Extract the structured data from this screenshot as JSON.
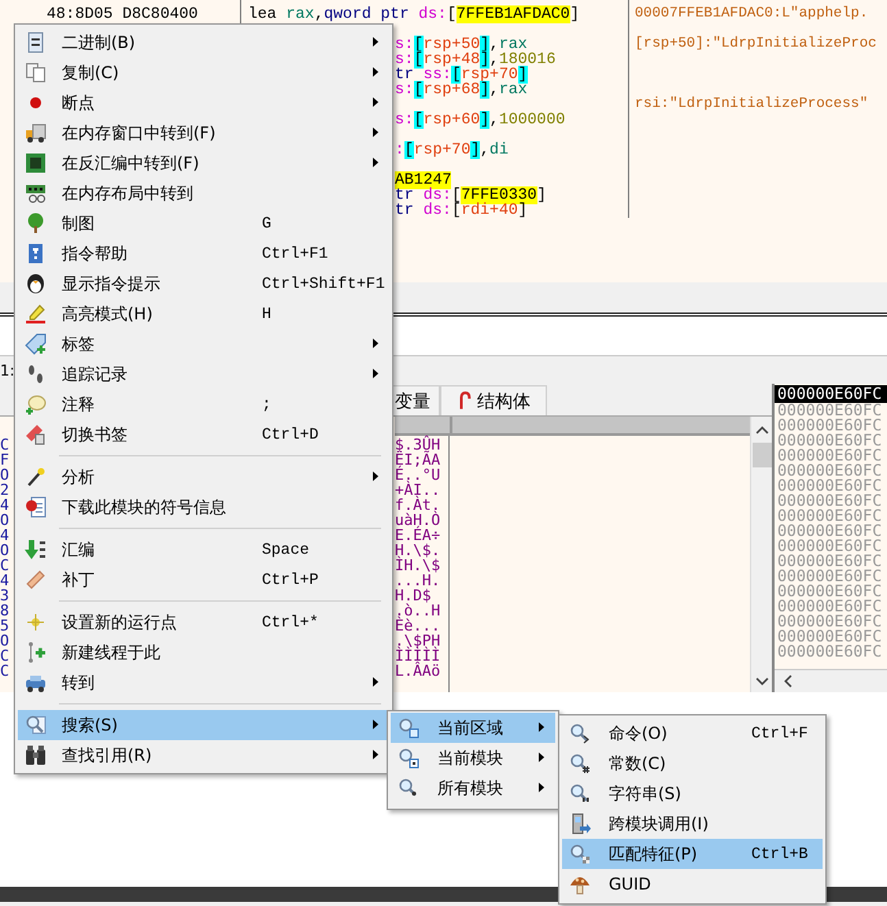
{
  "disassembly": {
    "rows": [
      {
        "kind": "covered"
      },
      {
        "kind": "full",
        "bytes": "48:8D05 D8C80400",
        "segments": [
          {
            "text": "lea ",
            "kind": "mnem"
          },
          {
            "text": "rax",
            "kind": "reg"
          },
          {
            "text": ",",
            "kind": "p"
          },
          {
            "text": "qword ptr ",
            "kind": "size"
          },
          {
            "text": "ds:",
            "kind": "seg"
          },
          {
            "text": "[",
            "kind": "p"
          },
          {
            "text": "7FFEB1AFDAC0",
            "kind": "addr"
          },
          {
            "text": "]",
            "kind": "p"
          }
        ],
        "comment": "00007FFEB1AFDAC0:L\"apphelp."
      },
      {
        "kind": "covered"
      },
      {
        "kind": "partial",
        "segments": [
          {
            "text": "s:",
            "kind": "seg"
          },
          {
            "text": "[",
            "kind": "br"
          },
          {
            "text": "rsp+50",
            "kind": "mem"
          },
          {
            "text": "]",
            "kind": "br"
          },
          {
            "text": ",",
            "kind": "p"
          },
          {
            "text": "rax",
            "kind": "reg"
          }
        ],
        "comment": "[rsp+50]:\"LdrpInitializeProc"
      },
      {
        "kind": "partial",
        "segments": [
          {
            "text": "s:",
            "kind": "seg"
          },
          {
            "text": "[",
            "kind": "br"
          },
          {
            "text": "rsp+48",
            "kind": "mem"
          },
          {
            "text": "]",
            "kind": "br"
          },
          {
            "text": ",",
            "kind": "p"
          },
          {
            "text": "180016",
            "kind": "num"
          }
        ]
      },
      {
        "kind": "partial",
        "segments": [
          {
            "text": "tr ",
            "kind": "size"
          },
          {
            "text": "ss:",
            "kind": "seg"
          },
          {
            "text": "[",
            "kind": "br"
          },
          {
            "text": "rsp+70",
            "kind": "mem"
          },
          {
            "text": "]",
            "kind": "br"
          }
        ]
      },
      {
        "kind": "partial",
        "segments": [
          {
            "text": "s:",
            "kind": "seg"
          },
          {
            "text": "[",
            "kind": "br"
          },
          {
            "text": "rsp+68",
            "kind": "mem"
          },
          {
            "text": "]",
            "kind": "br"
          },
          {
            "text": ",",
            "kind": "p"
          },
          {
            "text": "rax",
            "kind": "reg"
          }
        ]
      },
      {
        "kind": "covered",
        "comment": "rsi:\"LdrpInitializeProcess\""
      },
      {
        "kind": "partial",
        "segments": [
          {
            "text": "s:",
            "kind": "seg"
          },
          {
            "text": "[",
            "kind": "br"
          },
          {
            "text": "rsp+60",
            "kind": "mem"
          },
          {
            "text": "]",
            "kind": "br"
          },
          {
            "text": ",",
            "kind": "p"
          },
          {
            "text": "1000000",
            "kind": "num"
          }
        ]
      },
      {
        "kind": "covered"
      },
      {
        "kind": "partial",
        "segments": [
          {
            "text": ":",
            "kind": "seg"
          },
          {
            "text": "[",
            "kind": "br"
          },
          {
            "text": "rsp+70",
            "kind": "mem"
          },
          {
            "text": "]",
            "kind": "br"
          },
          {
            "text": ",",
            "kind": "p"
          },
          {
            "text": "di",
            "kind": "reg"
          }
        ]
      },
      {
        "kind": "covered"
      },
      {
        "kind": "partial",
        "segments": [
          {
            "text": "AB1247",
            "kind": "addr"
          }
        ]
      },
      {
        "kind": "partial",
        "segments": [
          {
            "text": "tr ",
            "kind": "size"
          },
          {
            "text": "ds:",
            "kind": "seg"
          },
          {
            "text": "[",
            "kind": "p"
          },
          {
            "text": "7FFE0330",
            "kind": "addr"
          },
          {
            "text": "]",
            "kind": "p"
          }
        ]
      },
      {
        "kind": "partial",
        "segments": [
          {
            "text": "tr ",
            "kind": "size"
          },
          {
            "text": "ds:",
            "kind": "seg"
          },
          {
            "text": "[",
            "kind": "p"
          },
          {
            "text": "rdi+40",
            "kind": "mem"
          },
          {
            "text": "]",
            "kind": "p"
          }
        ]
      }
    ]
  },
  "status_fragment": "1:",
  "dump": {
    "tabs": [
      {
        "label": "变量",
        "icon": false
      },
      {
        "label": "结构体",
        "icon": true
      }
    ],
    "rows": [
      {
        "edge": "C",
        "ascii": "$.3ÛH"
      },
      {
        "edge": "F",
        "ascii": "ËI;ÃA"
      },
      {
        "edge": "O",
        "ascii": "É..°U"
      },
      {
        "edge": "2",
        "ascii": "+ÀI.."
      },
      {
        "edge": "4",
        "ascii": "f.Àt."
      },
      {
        "edge": "O",
        "ascii": "uàH.Ò"
      },
      {
        "edge": "4",
        "ascii": "E.ÉA÷"
      },
      {
        "edge": "O",
        "ascii": "H.\\$."
      },
      {
        "edge": "C",
        "ascii": "ÌH.\\$"
      },
      {
        "edge": "4",
        "ascii": "...H."
      },
      {
        "edge": "3",
        "ascii": "H.D$"
      },
      {
        "edge": "8",
        "ascii": ".ò..H"
      },
      {
        "edge": "5",
        "ascii": "Èè..."
      },
      {
        "edge": "O",
        "ascii": ".\\$PH"
      },
      {
        "edge": "C",
        "ascii": "ÌÌÌÌÌ"
      },
      {
        "edge": "C",
        "ascii": "L.ÂAö"
      }
    ]
  },
  "stack": {
    "rows": [
      {
        "address": "000000E60FC",
        "selected": true
      },
      {
        "address": "000000E60FC",
        "selected": false
      },
      {
        "address": "000000E60FC",
        "selected": false
      },
      {
        "address": "000000E60FC",
        "selected": false
      },
      {
        "address": "000000E60FC",
        "selected": false
      },
      {
        "address": "000000E60FC",
        "selected": false
      },
      {
        "address": "000000E60FC",
        "selected": false
      },
      {
        "address": "000000E60FC",
        "selected": false
      },
      {
        "address": "000000E60FC",
        "selected": false
      },
      {
        "address": "000000E60FC",
        "selected": false
      },
      {
        "address": "000000E60FC",
        "selected": false
      },
      {
        "address": "000000E60FC",
        "selected": false
      },
      {
        "address": "000000E60FC",
        "selected": false
      },
      {
        "address": "000000E60FC",
        "selected": false
      },
      {
        "address": "000000E60FC",
        "selected": false
      },
      {
        "address": "000000E60FC",
        "selected": false
      },
      {
        "address": "000000E60FC",
        "selected": false
      },
      {
        "address": "000000E60FC",
        "selected": false
      }
    ]
  },
  "context_menu": {
    "items": [
      {
        "kind": "item",
        "label": "二进制(B)",
        "submenu": true,
        "selected": false
      },
      {
        "kind": "item",
        "label": "复制(C)",
        "submenu": true,
        "selected": false
      },
      {
        "kind": "item",
        "label": "断点",
        "submenu": true,
        "selected": false
      },
      {
        "kind": "item",
        "label": "在内存窗口中转到(F)",
        "submenu": true,
        "selected": false
      },
      {
        "kind": "item",
        "label": "在反汇编中转到(F)",
        "submenu": true,
        "selected": false
      },
      {
        "kind": "item",
        "label": "在内存布局中转到",
        "submenu": false,
        "selected": false
      },
      {
        "kind": "item",
        "label": "制图",
        "shortcut": "G",
        "submenu": false,
        "selected": false
      },
      {
        "kind": "item",
        "label": "指令帮助",
        "shortcut": "Ctrl+F1",
        "submenu": false,
        "selected": false
      },
      {
        "kind": "item",
        "label": "显示指令提示",
        "shortcut": "Ctrl+Shift+F1",
        "submenu": false,
        "selected": false
      },
      {
        "kind": "item",
        "label": "高亮模式(H)",
        "shortcut": "H",
        "submenu": false,
        "selected": false
      },
      {
        "kind": "item",
        "label": "标签",
        "submenu": true,
        "selected": false
      },
      {
        "kind": "item",
        "label": "追踪记录",
        "submenu": true,
        "selected": false
      },
      {
        "kind": "item",
        "label": "注释",
        "shortcut": ";",
        "submenu": false,
        "selected": false
      },
      {
        "kind": "item",
        "label": "切换书签",
        "shortcut": "Ctrl+D",
        "submenu": false,
        "selected": false
      },
      {
        "kind": "separator"
      },
      {
        "kind": "item",
        "label": "分析",
        "submenu": true,
        "selected": false
      },
      {
        "kind": "item",
        "label": "下载此模块的符号信息",
        "submenu": false,
        "selected": false
      },
      {
        "kind": "separator"
      },
      {
        "kind": "item",
        "label": "汇编",
        "shortcut": "Space",
        "submenu": false,
        "selected": false
      },
      {
        "kind": "item",
        "label": "补丁",
        "shortcut": "Ctrl+P",
        "submenu": false,
        "selected": false
      },
      {
        "kind": "separator"
      },
      {
        "kind": "item",
        "label": "设置新的运行点",
        "shortcut": "Ctrl+*",
        "submenu": false,
        "selected": false
      },
      {
        "kind": "item",
        "label": "新建线程于此",
        "submenu": false,
        "selected": false
      },
      {
        "kind": "item",
        "label": "转到",
        "submenu": true,
        "selected": false
      },
      {
        "kind": "separator"
      },
      {
        "kind": "item",
        "label": "搜索(S)",
        "submenu": true,
        "selected": true
      },
      {
        "kind": "item",
        "label": "查找引用(R)",
        "submenu": true,
        "selected": false
      }
    ]
  },
  "search_submenu": {
    "items": [
      {
        "label": "当前区域",
        "submenu": true,
        "selected": true
      },
      {
        "label": "当前模块",
        "submenu": true,
        "selected": false
      },
      {
        "label": "所有模块",
        "submenu": true,
        "selected": false
      }
    ]
  },
  "region_submenu": {
    "items": [
      {
        "label": "命令(O)",
        "shortcut": "Ctrl+F",
        "selected": false
      },
      {
        "label": "常数(C)",
        "selected": false
      },
      {
        "label": "字符串(S)",
        "selected": false
      },
      {
        "label": "跨模块调用(I)",
        "selected": false
      },
      {
        "label": "匹配特征(P)",
        "shortcut": "Ctrl+B",
        "selected": true
      },
      {
        "label": "GUID",
        "selected": false
      }
    ]
  }
}
